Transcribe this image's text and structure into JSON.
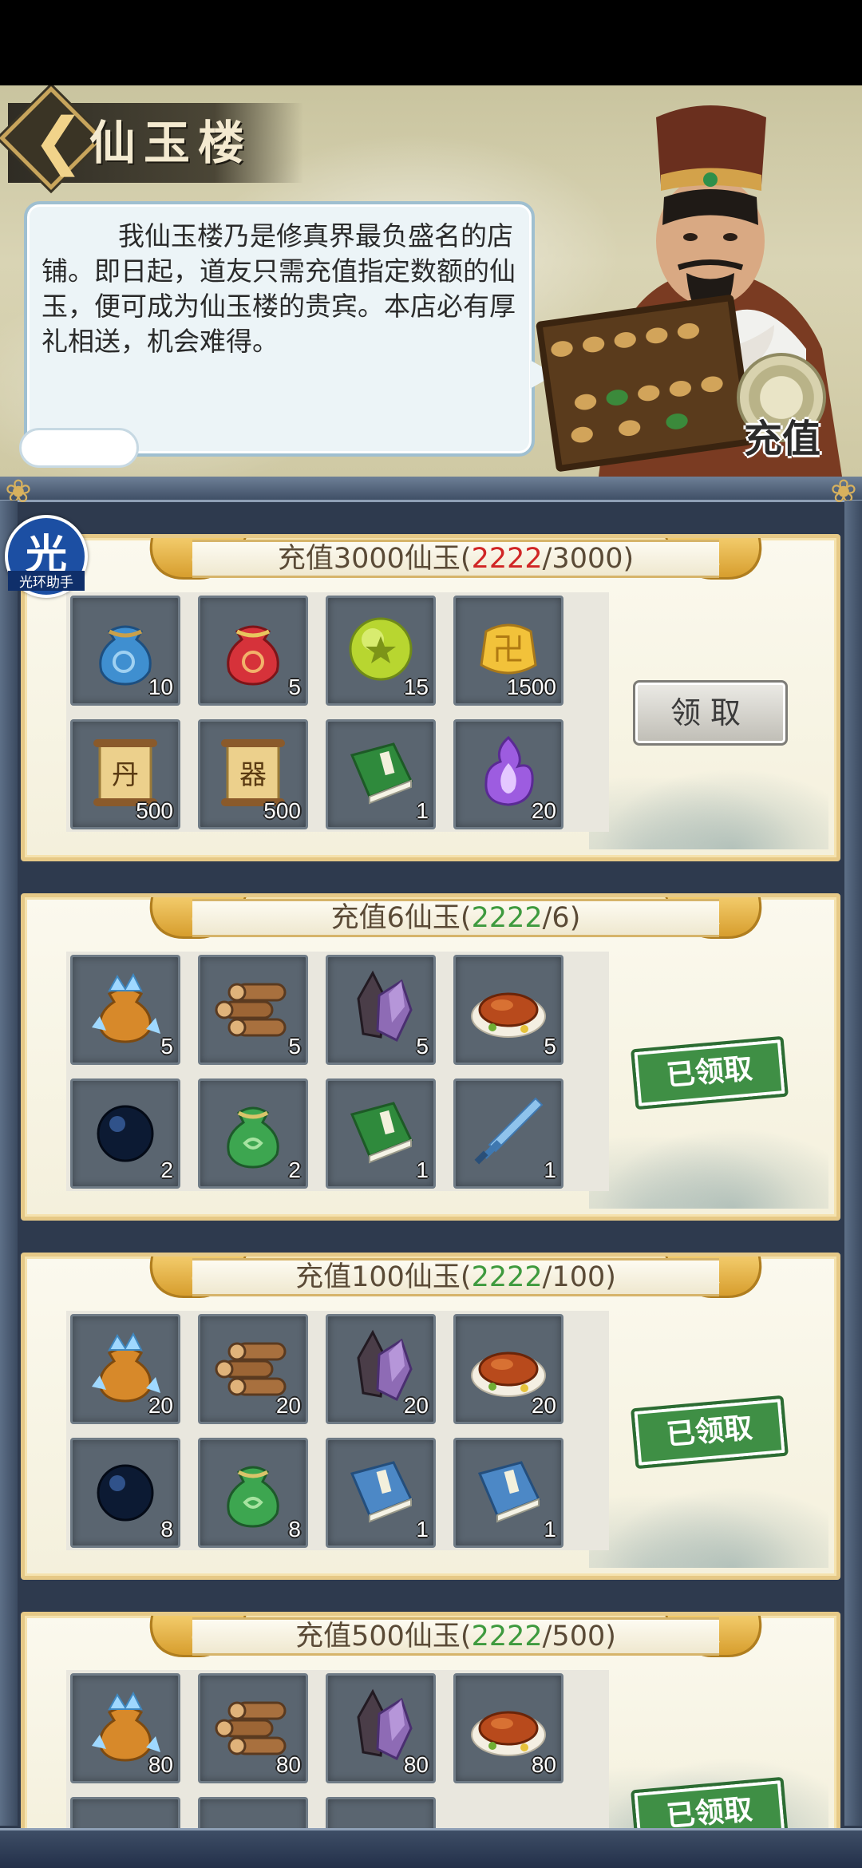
{
  "header": {
    "back_label": "❮",
    "title": "仙玉楼",
    "dialog": "我仙玉楼乃是修真界最负盛名的店铺。即日起，道友只需充值指定数额的仙玉，便可成为仙玉楼的贵宾。本店必有厚礼相送，机会难得。",
    "recharge_label": "充值"
  },
  "floating_badge": {
    "glyph": "光",
    "label": "光环助手"
  },
  "tiers": [
    {
      "title_prefix": "充值3000仙玉(",
      "progress_current": "2222",
      "progress_target": "/3000)",
      "progress_color": "#d02525",
      "status": "claimable",
      "button_label": "领取",
      "items": [
        {
          "icon": "blue-pouch-icon",
          "count": "10"
        },
        {
          "icon": "red-pouch-icon",
          "count": "5"
        },
        {
          "icon": "green-star-orb-icon",
          "count": "15"
        },
        {
          "icon": "gold-ingot-icon",
          "count": "1500"
        },
        {
          "icon": "dan-scroll-icon",
          "count": "500",
          "glyph": "丹"
        },
        {
          "icon": "qi-scroll-icon",
          "count": "500",
          "glyph": "器"
        },
        {
          "icon": "green-book-icon",
          "count": "1"
        },
        {
          "icon": "purple-flame-icon",
          "count": "20"
        }
      ]
    },
    {
      "title_prefix": "充值6仙玉(",
      "progress_current": "2222",
      "progress_target": "/6)",
      "progress_color": "#3e9a3e",
      "status": "claimed",
      "button_label": "已领取",
      "items": [
        {
          "icon": "crystal-bag-icon",
          "count": "5"
        },
        {
          "icon": "wood-logs-icon",
          "count": "5"
        },
        {
          "icon": "purple-crystal-icon",
          "count": "5"
        },
        {
          "icon": "roast-duck-icon",
          "count": "5"
        },
        {
          "icon": "dark-orb-icon",
          "count": "2"
        },
        {
          "icon": "green-pouch-icon",
          "count": "2"
        },
        {
          "icon": "green-book-icon",
          "count": "1"
        },
        {
          "icon": "blue-sword-icon",
          "count": "1"
        }
      ]
    },
    {
      "title_prefix": "充值100仙玉(",
      "progress_current": "2222",
      "progress_target": "/100)",
      "progress_color": "#3e9a3e",
      "status": "claimed",
      "button_label": "已领取",
      "items": [
        {
          "icon": "crystal-bag-icon",
          "count": "20"
        },
        {
          "icon": "wood-logs-icon",
          "count": "20"
        },
        {
          "icon": "purple-crystal-icon",
          "count": "20"
        },
        {
          "icon": "roast-duck-icon",
          "count": "20"
        },
        {
          "icon": "dark-orb-icon",
          "count": "8"
        },
        {
          "icon": "green-pouch-icon",
          "count": "8"
        },
        {
          "icon": "blue-book-icon",
          "count": "1"
        },
        {
          "icon": "blue-book-icon",
          "count": "1"
        }
      ]
    },
    {
      "title_prefix": "充值500仙玉(",
      "progress_current": "2222",
      "progress_target": "/500)",
      "progress_color": "#3e9a3e",
      "status": "claimed",
      "button_label": "已领取",
      "items": [
        {
          "icon": "crystal-bag-icon",
          "count": "80"
        },
        {
          "icon": "wood-logs-icon",
          "count": "80"
        },
        {
          "icon": "purple-crystal-icon",
          "count": "80"
        },
        {
          "icon": "roast-duck-icon",
          "count": "80"
        }
      ]
    }
  ]
}
